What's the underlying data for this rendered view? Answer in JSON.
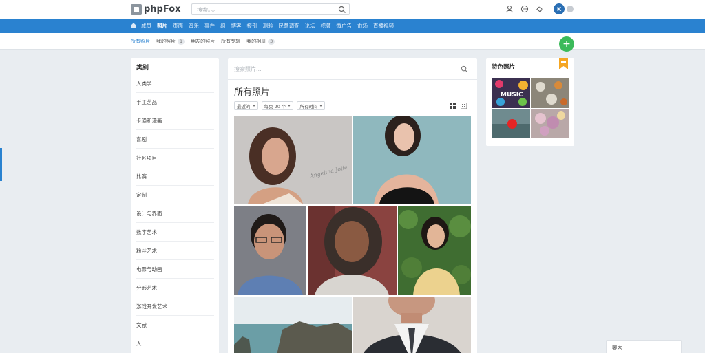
{
  "header": {
    "logo_text": "phpFox",
    "search_placeholder": "搜索。。。",
    "avatar_initial": "K",
    "icons": [
      "people-icon",
      "chat-icon",
      "bell-icon"
    ]
  },
  "nav": {
    "items": [
      "成员",
      "照片",
      "页面",
      "音乐",
      "事件",
      "组",
      "博客",
      "报引",
      "测验",
      "民意调查",
      "论坛",
      "视频",
      "微广告",
      "市场",
      "直播视频"
    ],
    "active": "照片"
  },
  "subnav": {
    "tabs": [
      {
        "label": "所有照片",
        "count": ""
      },
      {
        "label": "我的照片",
        "count": "1"
      },
      {
        "label": "朋友的照片",
        "count": ""
      },
      {
        "label": "所有专辑",
        "count": ""
      },
      {
        "label": "我的相册",
        "count": "3"
      }
    ],
    "fab_label": "+"
  },
  "categories": {
    "title": "类别",
    "items": [
      "人类学",
      "手工艺品",
      "卡通和漫画",
      "喜剧",
      "社区项目",
      "比赛",
      "定制",
      "设计与界面",
      "数字艺术",
      "粉丝艺术",
      "电影与动画",
      "分形艺术",
      "游戏开发艺术",
      "文献",
      "人"
    ]
  },
  "main": {
    "search_placeholder": "搜索照片...",
    "title": "所有照片",
    "filters": [
      "最近的",
      "每页 20 个",
      "所有时间"
    ],
    "photos": [
      {
        "name": "photo-woman-dark-hair",
        "color": "#a8928a"
      },
      {
        "name": "photo-woman-black-dress",
        "color": "#8fb6bd"
      },
      {
        "name": "photo-man-glasses",
        "color": "#7a8190"
      },
      {
        "name": "photo-woman-smiling-dreadlocks",
        "color": "#8e7a6c"
      },
      {
        "name": "photo-woman-green-leaves",
        "color": "#4f7a3c"
      },
      {
        "name": "photo-coastal-cliffs",
        "color": "#6e9aa3"
      },
      {
        "name": "photo-man-suit",
        "color": "#c5b3a3"
      }
    ],
    "photo_overlay_text": "Angelina Jolie"
  },
  "featured": {
    "title": "特色照片",
    "thumb_text": "MUSIC"
  },
  "chat": {
    "label": "聊天"
  }
}
